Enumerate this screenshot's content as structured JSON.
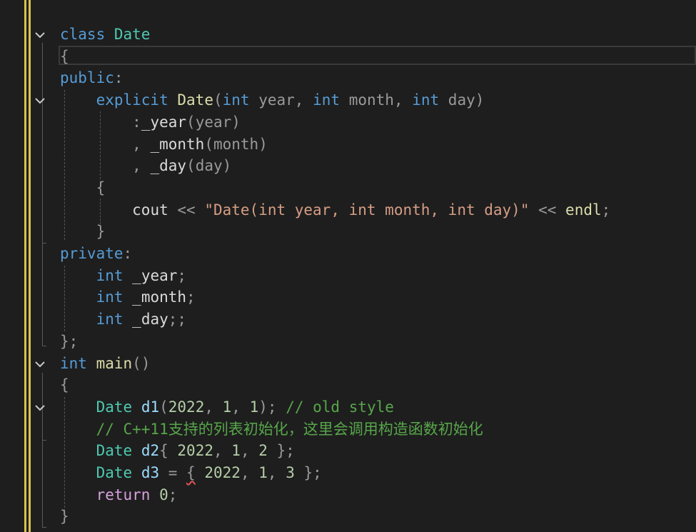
{
  "editor": {
    "lines": [
      {
        "tokens": [
          {
            "t": "class",
            "c": "kw"
          },
          {
            "t": " "
          },
          {
            "t": "Date",
            "c": "ty"
          }
        ]
      },
      {
        "tokens": [
          {
            "t": "{",
            "c": "pm"
          }
        ]
      },
      {
        "tokens": [
          {
            "t": "public",
            "c": "kw"
          },
          {
            "t": ":",
            "c": "pm"
          }
        ]
      },
      {
        "tokens": [
          {
            "t": "    "
          },
          {
            "t": "explicit",
            "c": "kw"
          },
          {
            "t": " "
          },
          {
            "t": "Date",
            "c": "fn"
          },
          {
            "t": "(",
            "c": "pm"
          },
          {
            "t": "int",
            "c": "kw"
          },
          {
            "t": " "
          },
          {
            "t": "year",
            "c": "pm"
          },
          {
            "t": ", ",
            "c": "pm"
          },
          {
            "t": "int",
            "c": "kw"
          },
          {
            "t": " "
          },
          {
            "t": "month",
            "c": "pm"
          },
          {
            "t": ", ",
            "c": "pm"
          },
          {
            "t": "int",
            "c": "kw"
          },
          {
            "t": " "
          },
          {
            "t": "day",
            "c": "pm"
          },
          {
            "t": ")",
            "c": "pm"
          }
        ]
      },
      {
        "tokens": [
          {
            "t": "        "
          },
          {
            "t": ":",
            "c": "pm"
          },
          {
            "t": "_year",
            "c": "mb"
          },
          {
            "t": "(",
            "c": "pm"
          },
          {
            "t": "year",
            "c": "pm"
          },
          {
            "t": ")",
            "c": "pm"
          }
        ]
      },
      {
        "tokens": [
          {
            "t": "        "
          },
          {
            "t": ", ",
            "c": "pm"
          },
          {
            "t": "_month",
            "c": "mb"
          },
          {
            "t": "(",
            "c": "pm"
          },
          {
            "t": "month",
            "c": "pm"
          },
          {
            "t": ")",
            "c": "pm"
          }
        ]
      },
      {
        "tokens": [
          {
            "t": "        "
          },
          {
            "t": ", ",
            "c": "pm"
          },
          {
            "t": "_day",
            "c": "mb"
          },
          {
            "t": "(",
            "c": "pm"
          },
          {
            "t": "day",
            "c": "pm"
          },
          {
            "t": ")",
            "c": "pm"
          }
        ]
      },
      {
        "tokens": [
          {
            "t": "    "
          },
          {
            "t": "{",
            "c": "pm"
          }
        ]
      },
      {
        "tokens": [
          {
            "t": "        "
          },
          {
            "t": "cout",
            "c": "id"
          },
          {
            "t": " << ",
            "c": "pm"
          },
          {
            "t": "\"Date(int year, int month, int day)\"",
            "c": "st"
          },
          {
            "t": " << ",
            "c": "pm"
          },
          {
            "t": "endl",
            "c": "fn"
          },
          {
            "t": ";",
            "c": "pm"
          }
        ]
      },
      {
        "tokens": [
          {
            "t": "    "
          },
          {
            "t": "}",
            "c": "pm"
          }
        ]
      },
      {
        "tokens": [
          {
            "t": "private",
            "c": "kw"
          },
          {
            "t": ":",
            "c": "pm"
          }
        ]
      },
      {
        "tokens": [
          {
            "t": "    "
          },
          {
            "t": "int",
            "c": "kw"
          },
          {
            "t": " "
          },
          {
            "t": "_year",
            "c": "mb"
          },
          {
            "t": ";",
            "c": "pm"
          }
        ]
      },
      {
        "tokens": [
          {
            "t": "    "
          },
          {
            "t": "int",
            "c": "kw"
          },
          {
            "t": " "
          },
          {
            "t": "_month",
            "c": "mb"
          },
          {
            "t": ";",
            "c": "pm"
          }
        ]
      },
      {
        "tokens": [
          {
            "t": "    "
          },
          {
            "t": "int",
            "c": "kw"
          },
          {
            "t": " "
          },
          {
            "t": "_day",
            "c": "mb"
          },
          {
            "t": ";;",
            "c": "pm"
          }
        ]
      },
      {
        "tokens": [
          {
            "t": "};",
            "c": "pm"
          }
        ]
      },
      {
        "tokens": [
          {
            "t": "int",
            "c": "kw"
          },
          {
            "t": " "
          },
          {
            "t": "main",
            "c": "fn"
          },
          {
            "t": "()",
            "c": "pm"
          }
        ]
      },
      {
        "tokens": [
          {
            "t": "{",
            "c": "pm"
          }
        ]
      },
      {
        "tokens": [
          {
            "t": "    "
          },
          {
            "t": "Date",
            "c": "ty"
          },
          {
            "t": " "
          },
          {
            "t": "d1",
            "c": "va"
          },
          {
            "t": "(",
            "c": "pm"
          },
          {
            "t": "2022",
            "c": "nm"
          },
          {
            "t": ", ",
            "c": "pm"
          },
          {
            "t": "1",
            "c": "nm"
          },
          {
            "t": ", ",
            "c": "pm"
          },
          {
            "t": "1",
            "c": "nm"
          },
          {
            "t": "); ",
            "c": "pm"
          },
          {
            "t": "// old style",
            "c": "cm"
          }
        ]
      },
      {
        "tokens": [
          {
            "t": "    "
          },
          {
            "t": "// C++11支持的列表初始化，这里会调用构造函数初始化",
            "c": "cm"
          }
        ]
      },
      {
        "tokens": [
          {
            "t": "    "
          },
          {
            "t": "Date",
            "c": "ty"
          },
          {
            "t": " "
          },
          {
            "t": "d2",
            "c": "va"
          },
          {
            "t": "{ ",
            "c": "pm"
          },
          {
            "t": "2022",
            "c": "nm"
          },
          {
            "t": ", ",
            "c": "pm"
          },
          {
            "t": "1",
            "c": "nm"
          },
          {
            "t": ", ",
            "c": "pm"
          },
          {
            "t": "2",
            "c": "nm"
          },
          {
            "t": " };",
            "c": "pm"
          }
        ]
      },
      {
        "tokens": [
          {
            "t": "    "
          },
          {
            "t": "Date",
            "c": "ty"
          },
          {
            "t": " "
          },
          {
            "t": "d3",
            "c": "va"
          },
          {
            "t": " = ",
            "c": "pm"
          },
          {
            "t": "{",
            "c": "pm",
            "sq": true
          },
          {
            "t": " "
          },
          {
            "t": "2022",
            "c": "nm"
          },
          {
            "t": ", ",
            "c": "pm"
          },
          {
            "t": "1",
            "c": "nm"
          },
          {
            "t": ", ",
            "c": "pm"
          },
          {
            "t": "3",
            "c": "nm"
          },
          {
            "t": " };",
            "c": "pm"
          }
        ]
      },
      {
        "tokens": [
          {
            "t": "    "
          },
          {
            "t": "return",
            "c": "ct"
          },
          {
            "t": " "
          },
          {
            "t": "0",
            "c": "nm"
          },
          {
            "t": ";",
            "c": "pm"
          }
        ]
      },
      {
        "tokens": [
          {
            "t": "}",
            "c": "pm"
          }
        ]
      }
    ],
    "fold_lines": [
      0,
      3,
      15,
      17
    ]
  }
}
